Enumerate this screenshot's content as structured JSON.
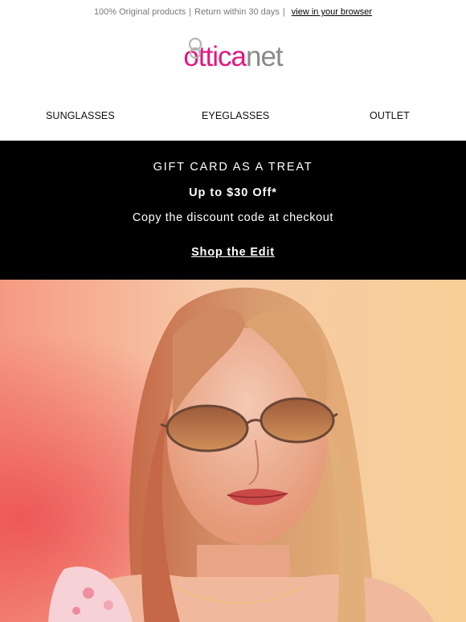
{
  "topbar": {
    "original": "100% Original products",
    "separator": "|",
    "returns": "Return within 30 days",
    "separator2": "|",
    "browser_link": "view in your browser"
  },
  "logo": {
    "part1": "ottica",
    "part2": "net",
    "pink": "#e3177f",
    "gray": "#8a8a8a"
  },
  "nav": {
    "sunglasses": "SUNGLASSES",
    "eyeglasses": "EYEGLASSES",
    "outlet": "OUTLET"
  },
  "promo": {
    "headline": "GIFT CARD AS A TREAT",
    "offer": "Up to $30 Off*",
    "instruction": "Copy the discount code at checkout",
    "cta": "Shop the Edit",
    "background": "#000000"
  },
  "hero": {
    "icon": "model-wearing-sunglasses-photo"
  }
}
